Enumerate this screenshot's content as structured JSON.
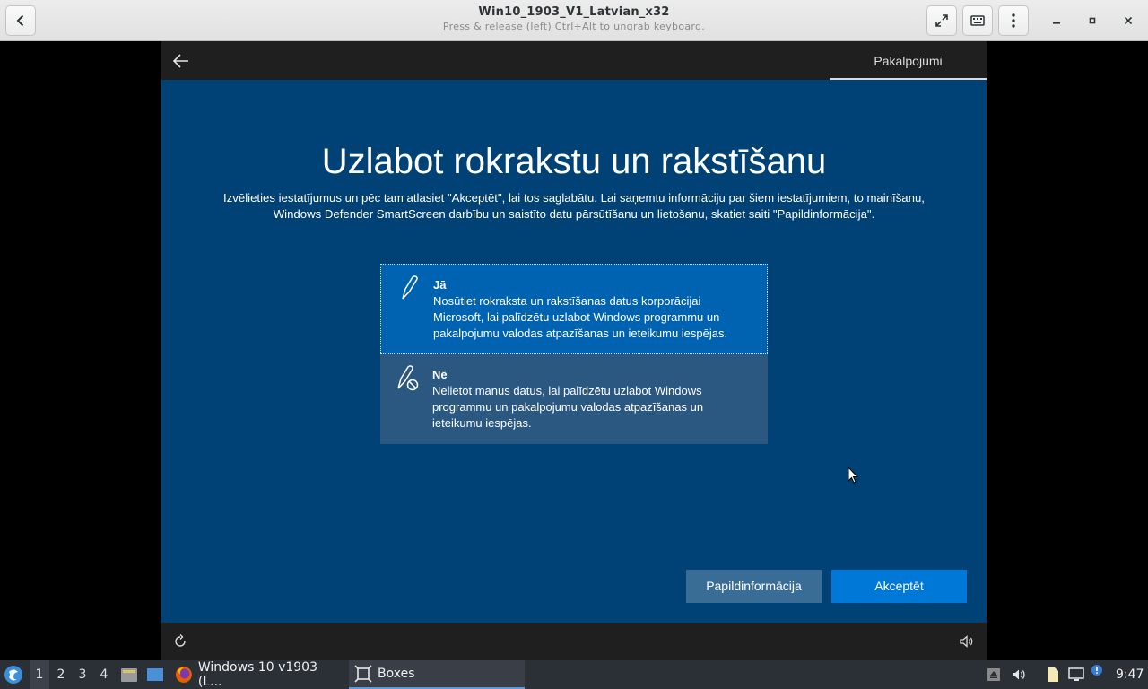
{
  "window": {
    "title": "Win10_1903_V1_Latvian_x32",
    "subtitle": "Press & release (left) Ctrl+Alt to ungrab keyboard."
  },
  "header_buttons": [
    "back-icon",
    "fullscreen-icon",
    "keyboard-icon",
    "menu-icon",
    "minimize-icon",
    "maximize-icon",
    "close-icon"
  ],
  "vm": {
    "tab_label": "Pakalpojumi",
    "title": "Uzlabot rokrakstu un rakstīšanu",
    "description": "Izvēlieties iestatījumus un pēc tam atlasiet \"Akceptēt\", lai tos saglabātu. Lai saņemtu informāciju par šiem iestatījumiem, to mainīšanu, Windows Defender SmartScreen darbību un saistīto datu pārsūtīšanu un lietošanu, skatiet saiti \"Papildinformācija\".",
    "options": [
      {
        "title": "Jā",
        "text": "Nosūtiet rokraksta un rakstīšanas datus korporācijai Microsoft, lai palīdzētu uzlabot Windows programmu un pakalpojumu valodas atpazīšanas un ieteikumu iespējas.",
        "selected": true
      },
      {
        "title": "Nē",
        "text": "Nelietot manus datus, lai palīdzētu uzlabot Windows programmu un pakalpojumu valodas atpazīšanas un ieteikumu iespējas.",
        "selected": false
      }
    ],
    "more_info_label": "Papildinformācija",
    "accept_label": "Akceptēt"
  },
  "colors": {
    "vm_background": "#004275",
    "selected_option": "#0063b1",
    "accept_button": "#0078d7"
  },
  "taskbar": {
    "workspaces": [
      "1",
      "2",
      "3",
      "4"
    ],
    "active_workspace": "1",
    "tasks": [
      {
        "label": "Windows 10 v1903 (L...",
        "icon": "firefox-icon"
      },
      {
        "label": "Boxes",
        "icon": "boxes-icon"
      }
    ],
    "clock": "9:47"
  }
}
